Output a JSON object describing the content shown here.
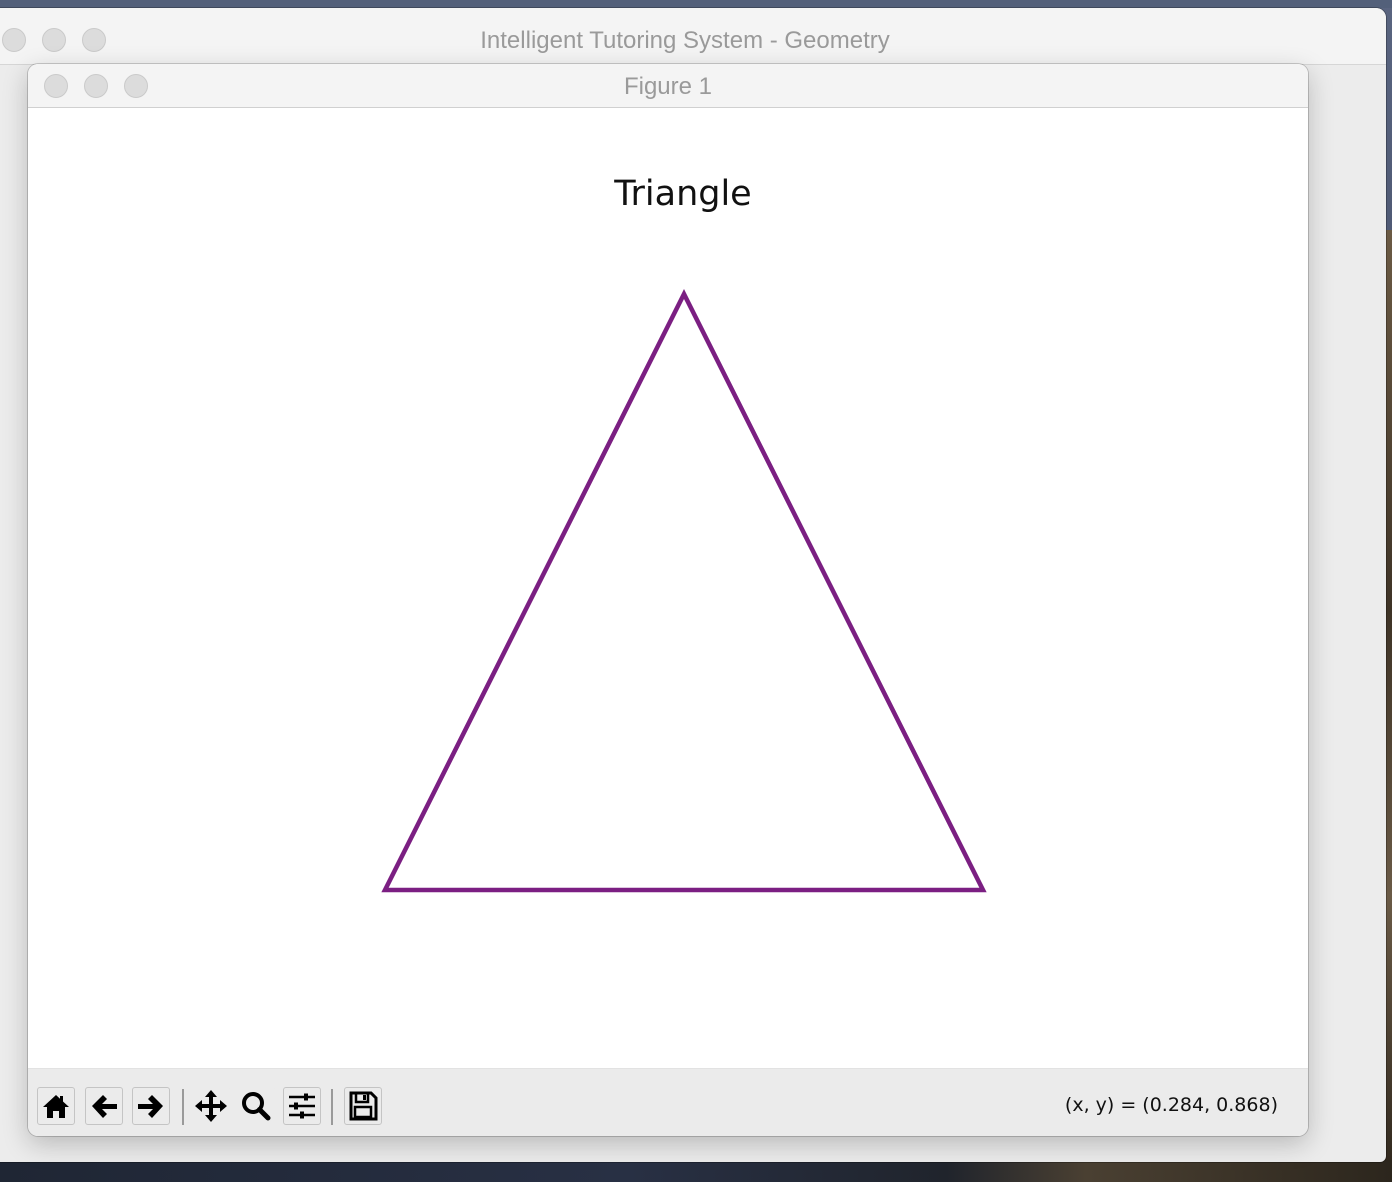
{
  "back_window": {
    "title": "Intelligent Tutoring System - Geometry"
  },
  "figure_window": {
    "title": "Figure 1"
  },
  "plot": {
    "title": "Triangle",
    "line_color": "#7b1f82",
    "shape": "triangle"
  },
  "toolbar": {
    "buttons": [
      {
        "name": "home",
        "icon": "home-icon"
      },
      {
        "name": "back",
        "icon": "arrow-left-icon"
      },
      {
        "name": "forward",
        "icon": "arrow-right-icon"
      },
      {
        "name": "pan",
        "icon": "move-icon"
      },
      {
        "name": "zoom",
        "icon": "magnifier-icon"
      },
      {
        "name": "configure-subplots",
        "icon": "sliders-icon"
      },
      {
        "name": "save",
        "icon": "floppy-disk-icon"
      }
    ],
    "coordinates": "(x, y) = (0.284, 0.868)"
  }
}
